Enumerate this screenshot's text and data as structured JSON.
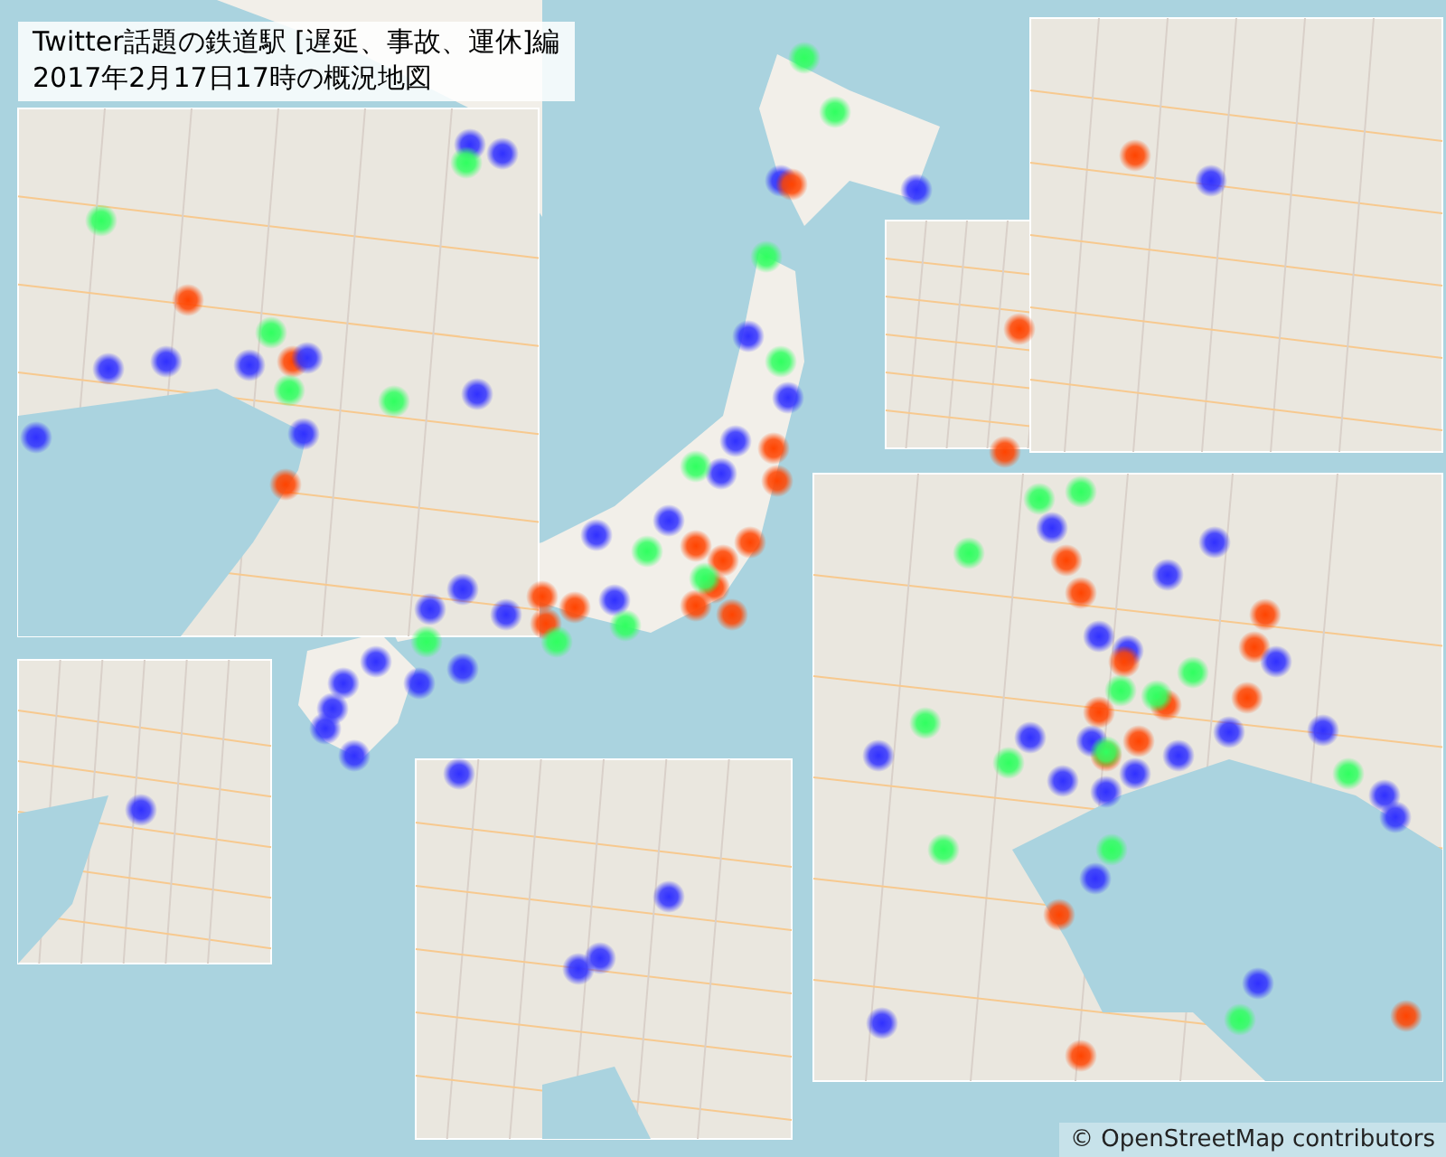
{
  "title": {
    "lines": [
      "Twitter話題の鉄道駅 [遅延、事故、運休]編",
      "2017年2月17日17時の概況地図"
    ]
  },
  "attribution": "© OpenStreetMap contributors"
}
